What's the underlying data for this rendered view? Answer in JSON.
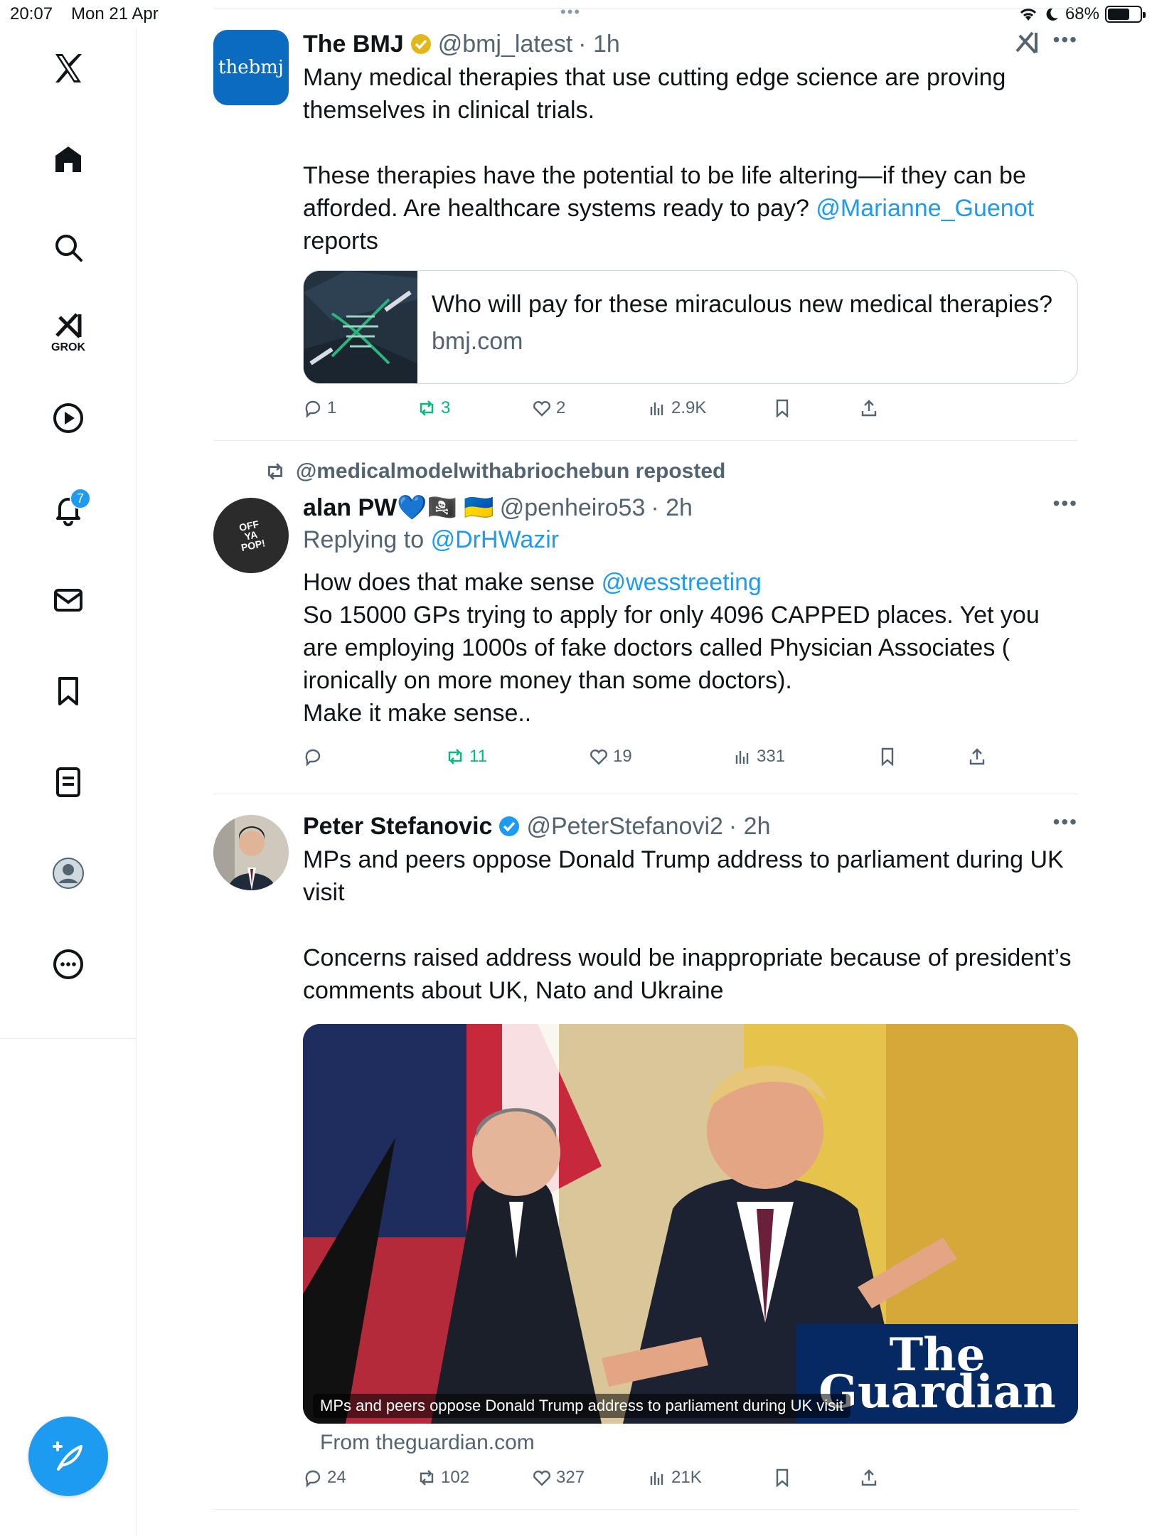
{
  "status_bar": {
    "time": "20:07",
    "date": "Mon 21 Apr",
    "battery": "68%",
    "battery_level": 0.68
  },
  "sidebar": {
    "items": [
      {
        "icon": "x-logo-icon"
      },
      {
        "icon": "home-icon"
      },
      {
        "icon": "search-icon"
      },
      {
        "icon": "grok-icon",
        "label": "GROK"
      },
      {
        "icon": "video-play-icon"
      },
      {
        "icon": "bell-icon",
        "badge": "7"
      },
      {
        "icon": "mail-icon"
      },
      {
        "icon": "bookmark-icon"
      },
      {
        "icon": "lists-icon"
      },
      {
        "icon": "profile-icon"
      },
      {
        "icon": "more-circle-icon"
      }
    ],
    "compose_icon": "compose-feather-icon"
  },
  "posts": [
    {
      "name": "The BMJ",
      "handle": "@bmj_latest",
      "time": "· 1h",
      "avatar_text": "thebmj",
      "text_p1": "Many medical therapies that use cutting edge science are proving themselves in clinical trials.",
      "text_p2_a": "These therapies have the potential to be life altering—if they can be afforded. Are healthcare systems ready to pay?",
      "text_p2_mention": "@Marianne_Guenot",
      "text_p2_b": "reports",
      "card_title": "Who will pay for these miraculous new medical therapies?",
      "card_domain": "bmj.com",
      "replies": "1",
      "reposts": "3",
      "likes": "2",
      "views": "2.9K"
    },
    {
      "repost_by": "@medicalmodelwithabriochebun reposted",
      "name": "alan PW💙🏴‍☠️ 🇺🇦",
      "handle": "@penheiro53",
      "time": "· 2h",
      "replying_label": "Replying to",
      "replying_to": "@DrHWazir",
      "avatar_text": "OFF YA POP!",
      "line1_a": "How does that make sense",
      "line1_mention": "@wesstreeting",
      "line2": "So 15000 GPs trying to apply for only 4096 CAPPED places. Yet you are employing 1000s of fake doctors called Physician Associates ( ironically on more money than some doctors).",
      "line3": "Make it make sense..",
      "replies": "",
      "reposts": "11",
      "likes": "19",
      "views": "331"
    },
    {
      "name": "Peter Stefanovic",
      "handle": "@PeterStefanovi2",
      "time": "· 2h",
      "text_p1": "MPs and peers oppose Donald Trump address to parliament during UK visit",
      "text_p2": "Concerns raised address would be inappropriate because of president’s comments about UK, Nato and Ukraine",
      "media_caption": "MPs and peers oppose Donald Trump address to parliament during UK visit",
      "media_brand": "The Guardian",
      "from": "From theguardian.com",
      "replies": "24",
      "reposts": "102",
      "likes": "327",
      "views": "21K"
    }
  ],
  "colors": {
    "accent": "#1d9bf0",
    "repost_green": "#00ba7c",
    "muted": "#536471",
    "gold_verified": "#e2b719",
    "bmj_blue": "#0a6bbf",
    "guardian_blue": "#052962"
  }
}
